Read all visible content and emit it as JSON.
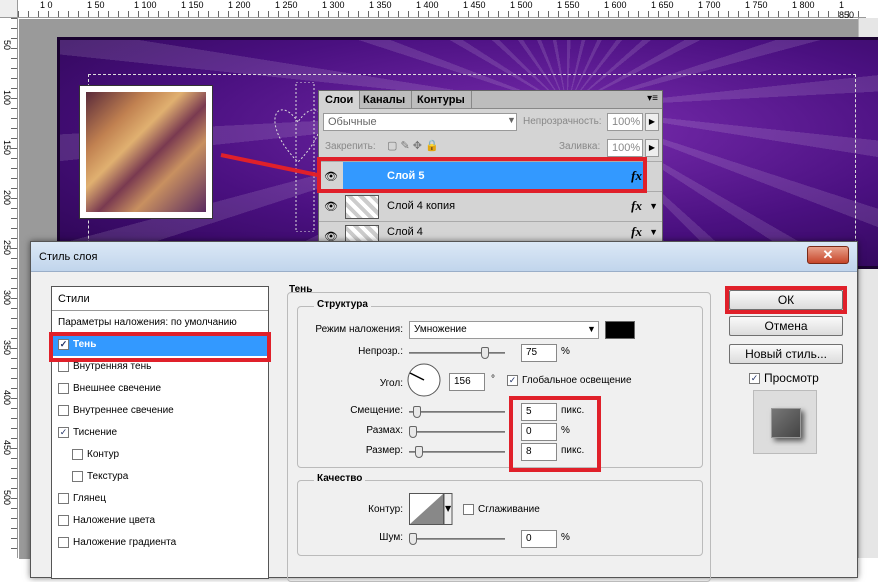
{
  "rulers": {
    "top": [
      "1 0",
      "1 50",
      "1 100",
      "1 150",
      "1 200",
      "1 250",
      "1 300",
      "1 350",
      "1 400",
      "1 450",
      "1 500",
      "1 550",
      "1 600",
      "1 650",
      "1 700",
      "1 750",
      "1 800",
      "1 850"
    ],
    "left": [
      "50",
      "100",
      "150",
      "200",
      "250",
      "300",
      "350",
      "400",
      "450",
      "500"
    ]
  },
  "layers_panel": {
    "tabs": [
      "Слои",
      "Каналы",
      "Контуры"
    ],
    "blend_mode": "Обычные",
    "opacity_label": "Непрозрачность:",
    "opacity_value": "100%",
    "lock_label": "Закрепить:",
    "fill_label": "Заливка:",
    "fill_value": "100%",
    "layers": [
      {
        "name": "Слой 5",
        "selected": true,
        "fx": "fx"
      },
      {
        "name": "Слой 4 копия",
        "selected": false,
        "fx": "fx"
      },
      {
        "name": "Слой 4",
        "selected": false,
        "fx": "fx"
      }
    ]
  },
  "dialog": {
    "title": "Стиль слоя",
    "close_label": "✕",
    "styles_header": "Стили",
    "styles": [
      {
        "label": "Параметры наложения: по умолчанию",
        "checkbox": false,
        "checked": false
      },
      {
        "label": "Тень",
        "checkbox": true,
        "checked": true,
        "selected": true
      },
      {
        "label": "Внутренняя тень",
        "checkbox": true,
        "checked": false
      },
      {
        "label": "Внешнее свечение",
        "checkbox": true,
        "checked": false
      },
      {
        "label": "Внутреннее свечение",
        "checkbox": true,
        "checked": false
      },
      {
        "label": "Тиснение",
        "checkbox": true,
        "checked": true
      },
      {
        "label": "Контур",
        "checkbox": true,
        "checked": false,
        "indent": true
      },
      {
        "label": "Текстура",
        "checkbox": true,
        "checked": false,
        "indent": true
      },
      {
        "label": "Глянец",
        "checkbox": true,
        "checked": false
      },
      {
        "label": "Наложение цвета",
        "checkbox": true,
        "checked": false
      },
      {
        "label": "Наложение градиента",
        "checkbox": true,
        "checked": false
      }
    ],
    "section_title": "Тень",
    "structure": {
      "title": "Структура",
      "blend_label": "Режим наложения:",
      "blend_value": "Умножение",
      "opacity_label": "Непрозр.:",
      "opacity_value": "75",
      "opacity_unit": "%",
      "angle_label": "Угол:",
      "angle_value": "156",
      "angle_unit": "°",
      "global_light_label": "Глобальное освещение",
      "offset_label": "Смещение:",
      "offset_value": "5",
      "offset_unit": "пикс.",
      "spread_label": "Размах:",
      "spread_value": "0",
      "spread_unit": "%",
      "size_label": "Размер:",
      "size_value": "8",
      "size_unit": "пикс."
    },
    "quality": {
      "title": "Качество",
      "contour_label": "Контур:",
      "antialias_label": "Сглаживание",
      "noise_label": "Шум:",
      "noise_value": "0",
      "noise_unit": "%"
    },
    "buttons": {
      "ok": "ОК",
      "cancel": "Отмена",
      "new_style": "Новый стиль...",
      "preview": "Просмотр"
    }
  },
  "colors": {
    "highlight_red": "#e0202a",
    "selection_blue": "#3399ff",
    "shadow_color": "#000000"
  }
}
